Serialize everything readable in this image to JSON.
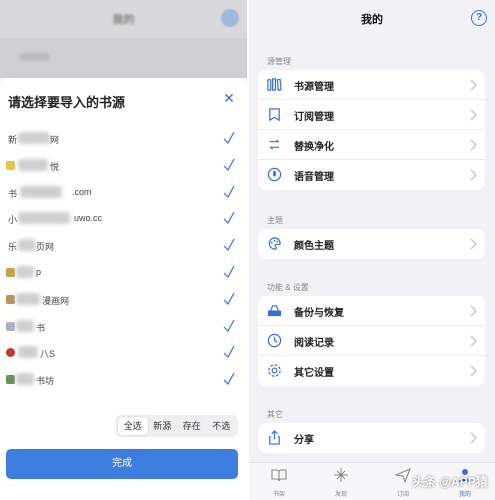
{
  "left": {
    "header_title": "我的",
    "dim_row_label": "源管理",
    "sheet": {
      "title": "请选择要导入的书源",
      "sources": [
        {
          "name": "新",
          "suffix": "网"
        },
        {
          "name": "",
          "suffix": "悦"
        },
        {
          "name": "书",
          "suffix": ".com"
        },
        {
          "name": "小",
          "suffix": "uwo.cc"
        },
        {
          "name": "乐",
          "suffix": "页网"
        },
        {
          "name": "",
          "suffix": "p"
        },
        {
          "name": "",
          "suffix": "漫画网"
        },
        {
          "name": "",
          "suffix": "书"
        },
        {
          "name": "",
          "suffix": "八S"
        },
        {
          "name": "",
          "suffix": "书坊"
        }
      ],
      "segments": [
        "全选",
        "新源",
        "存在",
        "不选"
      ],
      "active_segment": 0,
      "done_label": "完成"
    }
  },
  "right": {
    "title": "我的",
    "sections": [
      {
        "title": "源管理",
        "items": [
          {
            "label": "书源管理",
            "icon": "book-shelf-icon"
          },
          {
            "label": "订阅管理",
            "icon": "subscription-icon"
          },
          {
            "label": "替换净化",
            "icon": "replace-icon"
          },
          {
            "label": "语音管理",
            "icon": "voice-icon"
          }
        ]
      },
      {
        "title": "主题",
        "items": [
          {
            "label": "颜色主题",
            "icon": "palette-icon"
          }
        ]
      },
      {
        "title": "功能 & 设置",
        "items": [
          {
            "label": "备份与恢复",
            "icon": "backup-icon"
          },
          {
            "label": "阅读记录",
            "icon": "history-icon"
          },
          {
            "label": "其它设置",
            "icon": "settings-icon"
          }
        ]
      },
      {
        "title": "其它",
        "items": [
          {
            "label": "分享",
            "icon": "share-icon"
          }
        ]
      }
    ],
    "tabs": [
      {
        "label": "书架",
        "icon": "bookshelf-tab-icon"
      },
      {
        "label": "发现",
        "icon": "discover-tab-icon"
      },
      {
        "label": "订阅",
        "icon": "rss-tab-icon"
      },
      {
        "label": "我的",
        "icon": "me-tab-icon"
      }
    ],
    "active_tab": 3
  },
  "watermark": "头条 @APP猿",
  "colors": {
    "accent": "#3b6fd8",
    "button": "#3d7ddf"
  }
}
